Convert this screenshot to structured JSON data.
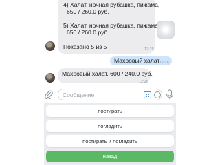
{
  "messages": {
    "catalog": {
      "line1": "4) Халат, ночная рубашка, пижама,",
      "line2": "650 / 260.0 руб.",
      "line3": "5) Халат, ночная рубашка, пижама,",
      "line4": "650 / 260.0 руб.",
      "line5": "Показано 5 из 5",
      "time": "12:25"
    },
    "outgoing": {
      "text": "Махровый халат",
      "time": "12:26"
    },
    "reply": {
      "text": "Махровый халат, 600 / 240.0 руб.",
      "time": "12:26"
    }
  },
  "composer": {
    "placeholder": "Сообщение"
  },
  "keyboard": {
    "buttons": [
      "постирать",
      "погладить",
      "постирать и погладить",
      "назад"
    ]
  },
  "colors": {
    "incoming_bubble": "#ececef",
    "outgoing_bubble": "#cfe4fb",
    "accent_button": "#5bb865"
  }
}
